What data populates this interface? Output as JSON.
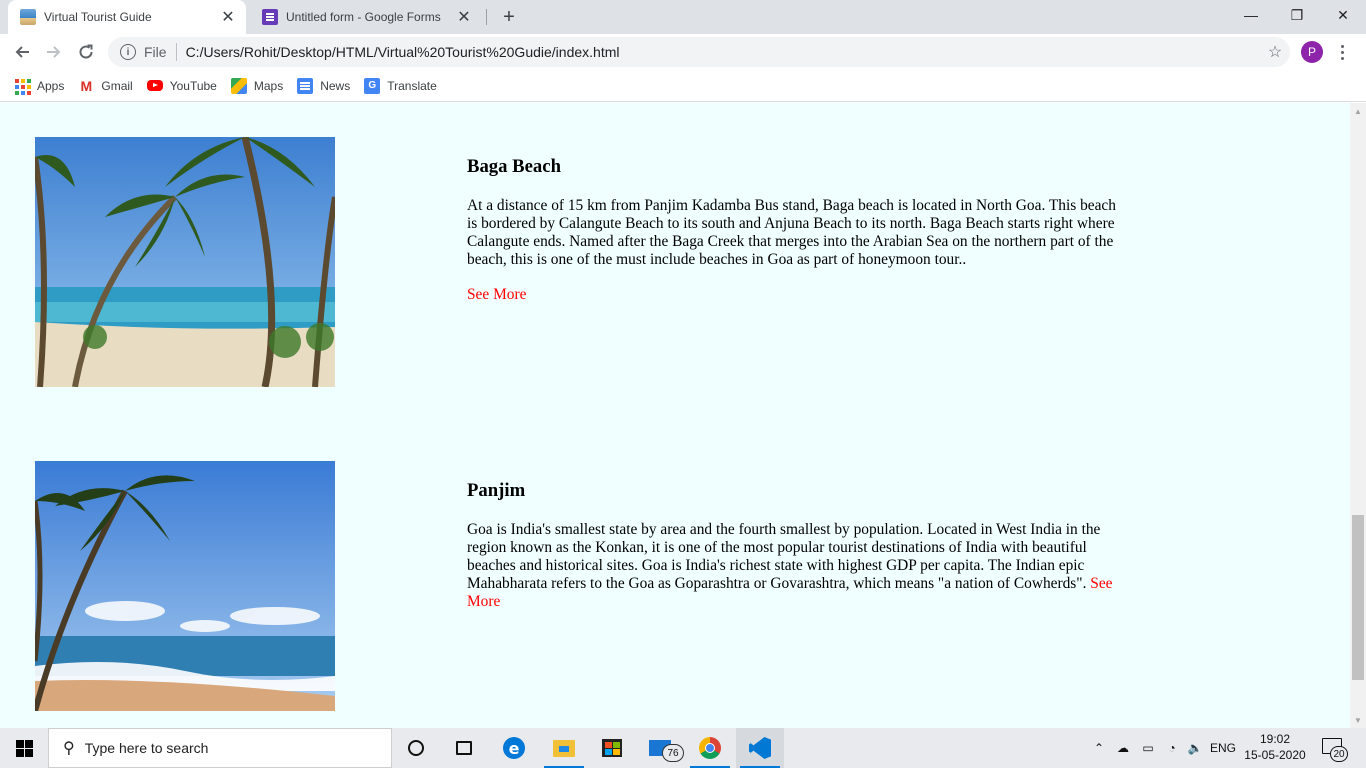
{
  "browser": {
    "tabs": [
      {
        "title": "Virtual Tourist Guide",
        "active": true
      },
      {
        "title": "Untitled form - Google Forms",
        "active": false
      }
    ],
    "address": {
      "scheme_label": "File",
      "url": "C:/Users/Rohit/Desktop/HTML/Virtual%20Tourist%20Gudie/index.html"
    },
    "profile_initial": "P",
    "bookmarks": [
      {
        "label": "Apps",
        "icon": "apps-grid-icon"
      },
      {
        "label": "Gmail",
        "icon": "gmail-icon"
      },
      {
        "label": "YouTube",
        "icon": "youtube-icon"
      },
      {
        "label": "Maps",
        "icon": "maps-icon"
      },
      {
        "label": "News",
        "icon": "news-icon"
      },
      {
        "label": "Translate",
        "icon": "translate-icon"
      }
    ]
  },
  "page": {
    "background": "#f0ffff",
    "link_color": "#ff0000",
    "places": [
      {
        "title": "Baga Beach",
        "description": "At a distance of 15 km from Panjim Kadamba Bus stand, Baga beach is located in North Goa. This beach is bordered by Calangute Beach to its south and Anjuna Beach to its north. Baga Beach starts right where Calangute ends. Named after the Baga Creek that merges into the Arabian Sea on the northern part of the beach, this is one of the must include beaches in Goa as part of honeymoon tour..",
        "link": "See More"
      },
      {
        "title": "Panjim",
        "description": "Goa is India's smallest state by area and the fourth smallest by population. Located in West India in the region known as the Konkan, it is one of the most popular tourist destinations of India with beautiful beaches and historical sites. Goa is India's richest state with highest GDP per capita. The Indian epic Mahabharata refers to the Goa as Goparashtra or Govarashtra, which means \"a nation of Cowherds\".",
        "link": "See More"
      }
    ]
  },
  "taskbar": {
    "search_placeholder": "Type here to search",
    "mail_badge": "76",
    "language": "ENG",
    "time": "19:02",
    "date": "15-05-2020",
    "notification_count": "20"
  }
}
